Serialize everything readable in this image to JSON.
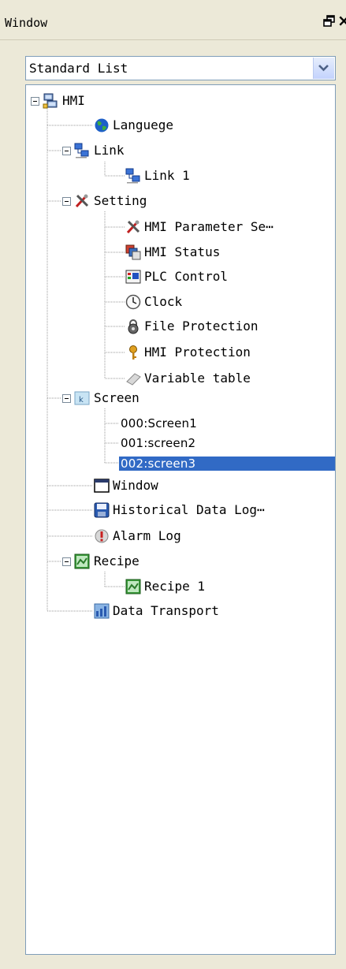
{
  "window": {
    "title": "Window"
  },
  "view_selector": {
    "value": "Standard List"
  },
  "tree": {
    "root": "HMI",
    "language": "Languege",
    "link": "Link",
    "link_1": "Link 1",
    "setting": "Setting",
    "hmi_parameter": "HMI Parameter Se⋯",
    "hmi_status": "HMI Status",
    "plc_control": "PLC Control",
    "clock": "Clock",
    "file_protection": "File Protection",
    "hmi_protection": "HMI Protection",
    "variable_table": "Variable table",
    "screen": "Screen",
    "screen_items": [
      "000:Screen1",
      "001:screen2",
      "002:screen3"
    ],
    "window_node": "Window",
    "historical": "Historical Data Log⋯",
    "alarm_log": "Alarm Log",
    "recipe": "Recipe",
    "recipe_1": "Recipe 1",
    "data_transport": "Data Transport"
  },
  "selected_item": "002:screen3",
  "colors": {
    "selection": "#316ac5",
    "panel_bg": "#ece9d8",
    "border": "#7f9db9"
  },
  "icons": {
    "root": "hmi-network-icon",
    "language": "globe-icon",
    "link": "link-computers-icon",
    "setting": "tools-icon",
    "hmi_status": "status-icon",
    "plc_control": "plc-control-icon",
    "clock": "clock-icon",
    "file_protection": "padlock-icon",
    "hmi_protection": "key-icon",
    "variable_table": "eraser-icon",
    "screen": "screen-icon",
    "window_node": "window-icon",
    "historical": "floppy-disk-icon",
    "alarm_log": "alarm-icon",
    "recipe": "recipe-icon",
    "data_transport": "data-transport-icon"
  }
}
